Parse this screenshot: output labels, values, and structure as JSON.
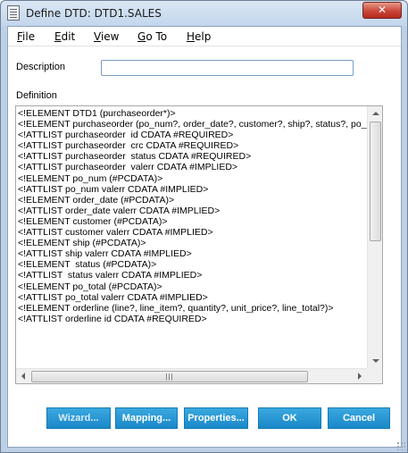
{
  "window": {
    "title": "Define DTD: DTD1.SALES",
    "close_glyph": "✕"
  },
  "menu": {
    "items": [
      {
        "key": "F",
        "rest": "ile"
      },
      {
        "key": "E",
        "rest": "dit"
      },
      {
        "key": "V",
        "rest": "iew"
      },
      {
        "key": "G",
        "rest": "o To"
      },
      {
        "key": "H",
        "rest": "elp"
      }
    ]
  },
  "form": {
    "description_label": "Description",
    "description_value": "",
    "definition_label": "Definition"
  },
  "definition": {
    "lines": [
      "<!ELEMENT DTD1 (purchaseorder*)>",
      "<!ELEMENT purchaseorder (po_num?, order_date?, customer?, ship?, status?, po_total?, orderline*)>",
      "<!ATTLIST purchaseorder  id CDATA #REQUIRED>",
      "<!ATTLIST purchaseorder  crc CDATA #REQUIRED>",
      "<!ATTLIST purchaseorder  status CDATA #REQUIRED>",
      "<!ATTLIST purchaseorder  valerr CDATA #IMPLIED>",
      "<!ELEMENT po_num (#PCDATA)>",
      "<!ATTLIST po_num valerr CDATA #IMPLIED>",
      "<!ELEMENT order_date (#PCDATA)>",
      "<!ATTLIST order_date valerr CDATA #IMPLIED>",
      "<!ELEMENT customer (#PCDATA)>",
      "<!ATTLIST customer valerr CDATA #IMPLIED>",
      "<!ELEMENT ship (#PCDATA)>",
      "<!ATTLIST ship valerr CDATA #IMPLIED>",
      "<!ELEMENT  status (#PCDATA)>",
      "<!ATTLIST  status valerr CDATA #IMPLIED>",
      "<!ELEMENT po_total (#PCDATA)>",
      "<!ATTLIST po_total valerr CDATA #IMPLIED>",
      "<!ELEMENT orderline (line?, line_item?, quantity?, unit_price?, line_total?)>",
      "<!ATTLIST orderline id CDATA #REQUIRED>"
    ],
    "h_thumb_grip": "|||"
  },
  "buttons": {
    "wizard": "Wizard...",
    "mapping": "Mapping...",
    "properties": "Properties...",
    "ok": "OK",
    "cancel": "Cancel"
  },
  "colors": {
    "button_blue": "#1b88c8",
    "frame": "#bcd0e6",
    "close_red": "#c9463a"
  }
}
